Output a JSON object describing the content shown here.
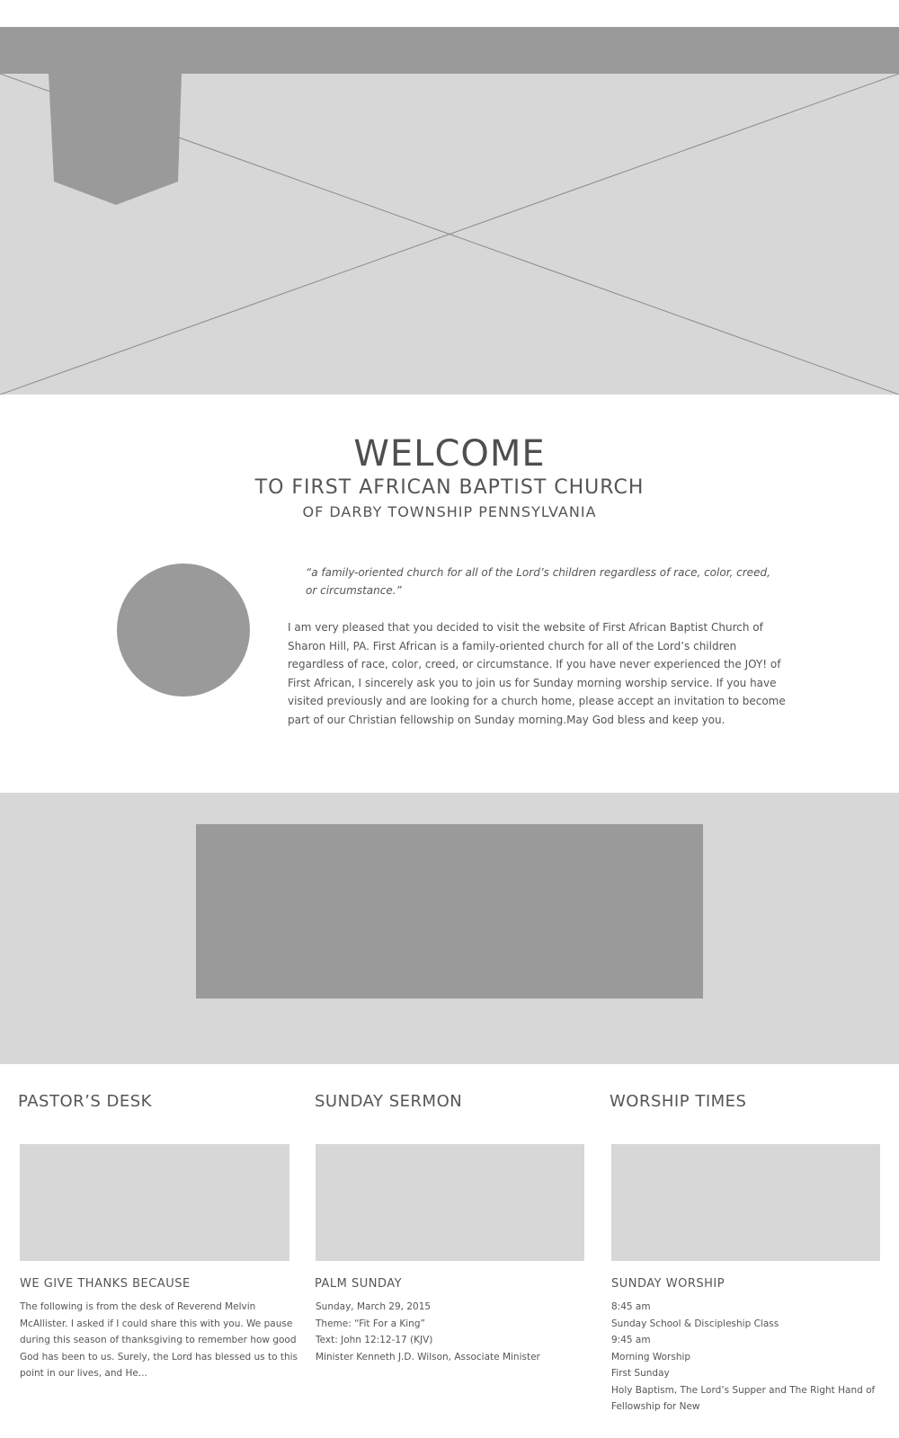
{
  "hero": {},
  "welcome": {
    "title": "WELCOME",
    "subtitle1": "TO FIRST AFRICAN BAPTIST CHURCH",
    "subtitle2": "OF DARBY TOWNSHIP PENNSYLVANIA",
    "quote": "“a family-oriented church for all of the Lord’s children regardless of race, color, creed, or circumstance.”",
    "body": "I am very pleased that you decided to visit the website of First African Baptist Church of Sharon Hill, PA. First African is a family-oriented church for all of the Lord’s children regardless of race, color, creed, or circumstance. If you have never experienced the JOY! of First African, I sincerely ask you to join us for Sunday morning worship service. If you have visited previously and are looking for a church home, please accept an invitation to become part of our Christian fellowship on Sunday morning.May God bless and keep you."
  },
  "columns": [
    {
      "title": "PASTOR’S DESK",
      "heading": "WE GIVE THANKS BECAUSE",
      "lines": [
        "The following is from the desk of Reverend Melvin",
        "McAllister. I asked if I could share this with you. We pause",
        "during this season of thanksgiving to remember how good",
        "God has been to us. Surely, the Lord has blessed us to this",
        "point in our lives, and He..."
      ]
    },
    {
      "title": "SUNDAY SERMON",
      "heading": "PALM SUNDAY",
      "lines": [
        "Sunday, March 29, 2015",
        "Theme: “Fit For a King”",
        "Text: John 12:12-17 (KJV)",
        "Minister Kenneth J.D. Wilson, Associate Minister"
      ]
    },
    {
      "title": "WORSHIP TIMES",
      "heading": "SUNDAY WORSHIP",
      "lines": [
        "8:45 am",
        "Sunday School & Discipleship Class",
        "9:45 am",
        "Morning Worship",
        "First Sunday",
        "Holy Baptism, The Lord’s Supper and The Right Hand of",
        "Fellowship for New"
      ]
    }
  ]
}
